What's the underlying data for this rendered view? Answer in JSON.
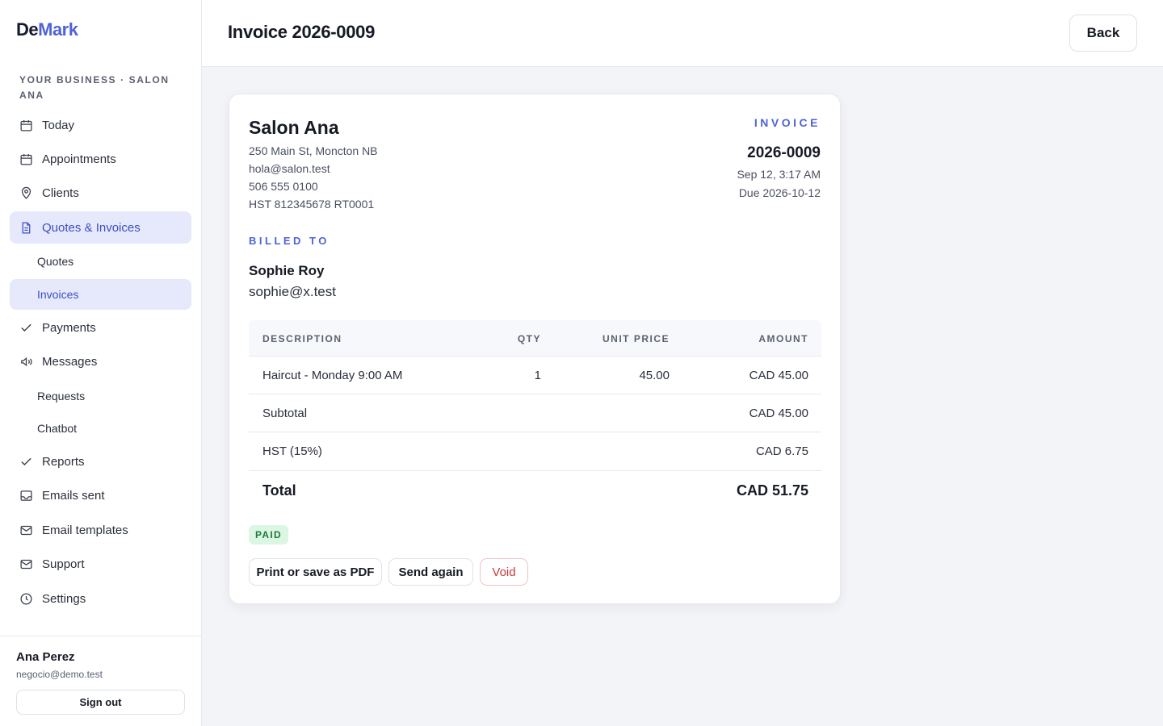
{
  "app": {
    "logo_part1": "De",
    "logo_part2": "Mark"
  },
  "sidebar": {
    "business_label": "YOUR BUSINESS · SALON ANA",
    "items": [
      {
        "label": "Today",
        "icon": "calendar-icon"
      },
      {
        "label": "Appointments",
        "icon": "calendar-icon"
      },
      {
        "label": "Clients",
        "icon": "map-pin-icon"
      },
      {
        "label": "Quotes & Invoices",
        "icon": "document-icon"
      },
      {
        "label": "Quotes"
      },
      {
        "label": "Invoices"
      },
      {
        "label": "Payments",
        "icon": "check-icon"
      },
      {
        "label": "Messages",
        "icon": "megaphone-icon"
      },
      {
        "label": "Requests"
      },
      {
        "label": "Chatbot"
      },
      {
        "label": "Reports",
        "icon": "check-icon"
      },
      {
        "label": "Emails sent",
        "icon": "inbox-icon"
      },
      {
        "label": "Email templates",
        "icon": "mail-icon"
      },
      {
        "label": "Support",
        "icon": "mail-icon"
      },
      {
        "label": "Settings",
        "icon": "clock-icon"
      }
    ],
    "user": {
      "name": "Ana Perez",
      "email": "negocio@demo.test",
      "sign_out": "Sign out"
    }
  },
  "header": {
    "title": "Invoice 2026-0009",
    "back_label": "Back"
  },
  "invoice": {
    "business": {
      "name": "Salon Ana",
      "address": "250 Main St, Moncton NB",
      "email": "hola@salon.test",
      "phone": "506 555 0100",
      "tax_id": "HST 812345678 RT0001"
    },
    "label": "INVOICE",
    "number": "2026-0009",
    "date": "Sep 12, 3:17 AM",
    "due": "Due 2026-10-12",
    "billed_to_label": "BILLED TO",
    "client": {
      "name": "Sophie Roy",
      "email": "sophie@x.test"
    },
    "columns": {
      "description": "DESCRIPTION",
      "qty": "QTY",
      "unit_price": "UNIT PRICE",
      "amount": "AMOUNT"
    },
    "line_items": [
      {
        "description": "Haircut - Monday 9:00 AM",
        "qty": "1",
        "unit_price": "45.00",
        "amount": "CAD 45.00"
      }
    ],
    "subtotal": {
      "label": "Subtotal",
      "value": "CAD 45.00"
    },
    "tax": {
      "label": "HST (15%)",
      "value": "CAD 6.75"
    },
    "total": {
      "label": "Total",
      "value": "CAD 51.75"
    },
    "status": "PAID",
    "status_color": "#1f7a3c",
    "actions": {
      "print": "Print or save as PDF",
      "send": "Send again",
      "void": "Void"
    }
  },
  "colors": {
    "accent": "#4f63d8",
    "danger": "#c93a3a",
    "paid_bg": "#dcf6e4"
  }
}
